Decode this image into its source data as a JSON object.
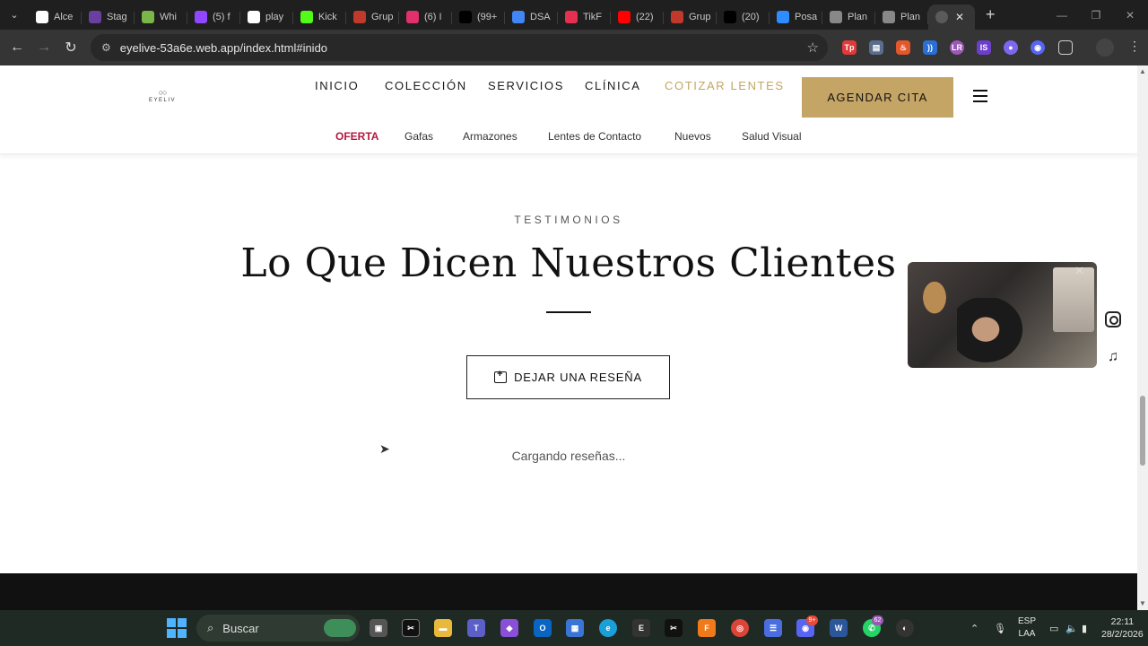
{
  "browser": {
    "tabs": [
      {
        "title": "Alce",
        "icon": "github-icon",
        "color": "#ffffff"
      },
      {
        "title": "Stag",
        "icon": "stage-icon",
        "color": "#6b3fa0"
      },
      {
        "title": "Whi",
        "icon": "leaf-icon",
        "color": "#7ab648"
      },
      {
        "title": "(5) f",
        "icon": "twitch-icon",
        "color": "#9146ff"
      },
      {
        "title": "play",
        "icon": "play-icon",
        "color": "#ffffff"
      },
      {
        "title": "Kick",
        "icon": "kick-icon",
        "color": "#53fc18"
      },
      {
        "title": "Grup",
        "icon": "group-icon",
        "color": "#c0392b"
      },
      {
        "title": "(6) I",
        "icon": "instagram-icon",
        "color": "#e1306c"
      },
      {
        "title": "(99+",
        "icon": "tiktok-icon",
        "color": "#000000"
      },
      {
        "title": "DSA",
        "icon": "docs-icon",
        "color": "#4285f4"
      },
      {
        "title": "TikF",
        "icon": "tikf-icon",
        "color": "#e5304f"
      },
      {
        "title": "(22)",
        "icon": "youtube-icon",
        "color": "#ff0000"
      },
      {
        "title": "Grup",
        "icon": "group-icon",
        "color": "#c0392b"
      },
      {
        "title": "(20)",
        "icon": "x-icon",
        "color": "#000000"
      },
      {
        "title": "Posa",
        "icon": "zoom-icon",
        "color": "#2d8cff"
      },
      {
        "title": "Plan",
        "icon": "globe-icon",
        "color": "#888888"
      },
      {
        "title": "Plan",
        "icon": "globe-icon",
        "color": "#888888"
      }
    ],
    "url": "eyelive-53a6e.web.app/index.html#inido"
  },
  "site": {
    "logo_text": "EYELIV",
    "nav": [
      "INICIO",
      "COLECCIÓN",
      "SERVICIOS",
      "CLÍNICA",
      "COTIZAR LENTES"
    ],
    "cta": "AGENDAR CITA",
    "subnav": [
      "OFERTA",
      "Gafas",
      "Armazones",
      "Lentes de Contacto",
      "Nuevos",
      "Salud Visual"
    ],
    "section": {
      "eyebrow": "TESTIMONIOS",
      "title": "Lo Que Dicen Nuestros Clientes",
      "button": "DEJAR UNA RESEÑA",
      "loading": "Cargando reseñas..."
    },
    "colors": {
      "gold": "#c5a565",
      "offer": "#b5173d"
    }
  },
  "taskbar": {
    "search_placeholder": "Buscar",
    "lang_line1": "ESP",
    "lang_line2": "LAA",
    "time": "22:11",
    "date": "28/2/2026",
    "teams_badge": "9+",
    "whatsapp_badge": "62"
  }
}
